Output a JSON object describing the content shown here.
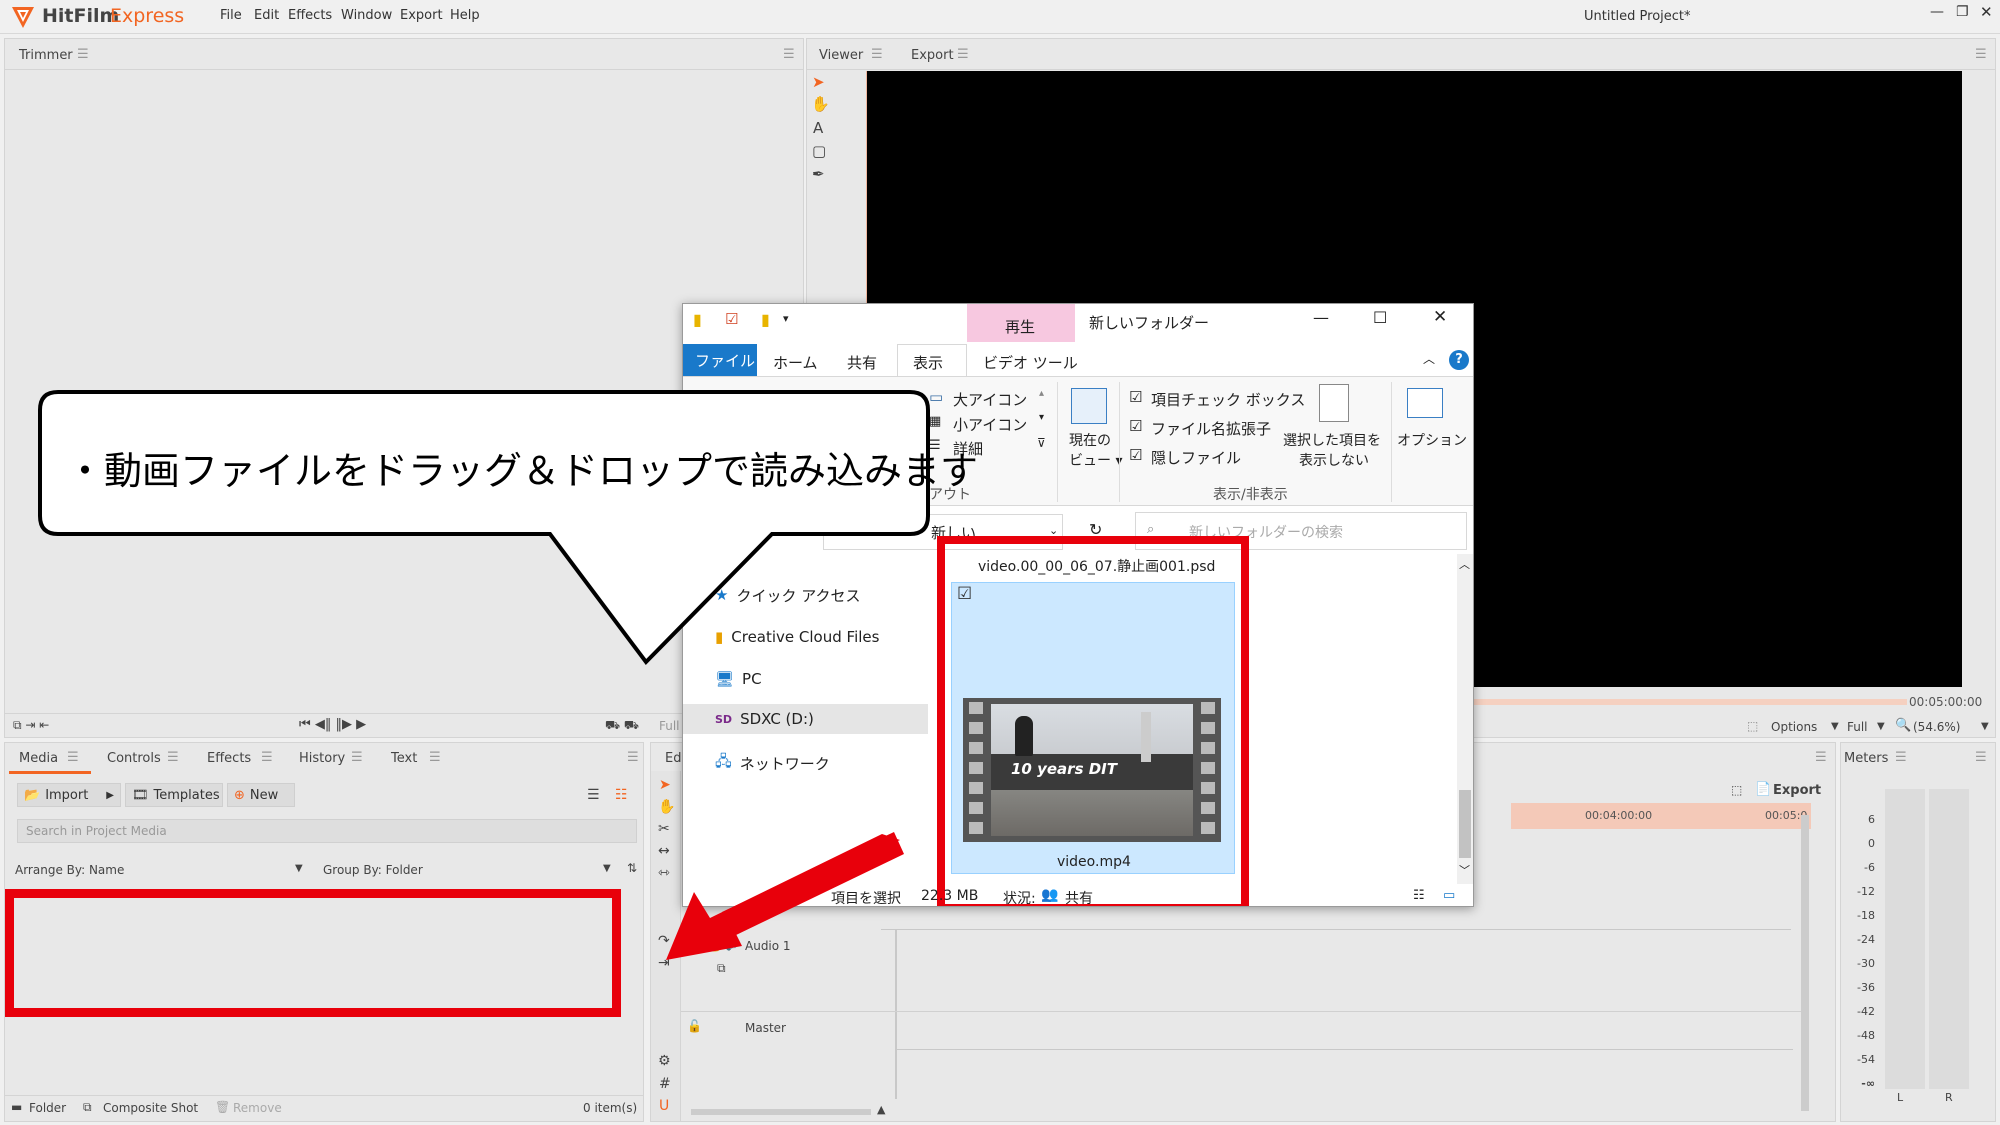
{
  "app": {
    "logo_text": "HitFilm",
    "logo_sub": "Express",
    "project_title": "Untitled Project*",
    "menu": [
      "File",
      "Edit",
      "Effects",
      "Window",
      "Export",
      "Help"
    ],
    "window_controls": [
      "—",
      "❐",
      "✕"
    ]
  },
  "trimmer": {
    "tab": "Trimmer",
    "full_label": "Full"
  },
  "viewer": {
    "tabs": [
      "Viewer",
      "Export"
    ],
    "timecode": "00:05:00:00",
    "options_label": "Options",
    "full_label": "Full",
    "zoom": "(54.6%)"
  },
  "media_panel": {
    "tabs": [
      "Media",
      "Controls",
      "Effects",
      "History",
      "Text"
    ],
    "import_label": "Import",
    "templates_label": "Templates",
    "new_label": "New",
    "search_placeholder": "Search in Project Media",
    "arrange_by": "Arrange By: Name",
    "group_by": "Group By: Folder",
    "folder_label": "Folder",
    "composite_label": "Composite Shot",
    "remove_label": "Remove",
    "items_count": "0 item(s)"
  },
  "editor": {
    "tab": "Edi",
    "export_label": "Export",
    "ruler": [
      "00:04:00:00",
      "00:05:0"
    ],
    "tracks": [
      "Audio 1",
      "Master"
    ]
  },
  "meters": {
    "tab": "Meters",
    "scale": [
      "6",
      "0",
      "-6",
      "-12",
      "-18",
      "-24",
      "-30",
      "-36",
      "-42",
      "-48",
      "-54",
      "-∞"
    ],
    "channels": [
      "L",
      "R"
    ]
  },
  "explorer": {
    "context_tab": "再生",
    "title": "新しいフォルダー",
    "ribbon_tabs": [
      "ファイル",
      "ホーム",
      "共有",
      "表示",
      "ビデオ ツール"
    ],
    "layout_items": [
      "大アイコン",
      "小アイコン",
      "詳細"
    ],
    "layout_group": "アウト",
    "current_view": [
      "現在の",
      "ビュー ▾"
    ],
    "checkboxes": [
      "項目チェック ボックス",
      "ファイル名拡張子",
      "隠しファイル"
    ],
    "hide_selected": [
      "選択した項目を",
      "表示しない"
    ],
    "options_label": "オプション",
    "showhide_group": "表示/非表示",
    "address_text": "新しい",
    "search_placeholder": "新しいフォルダーの検索",
    "nav": [
      "クイック アクセス",
      "Creative Cloud Files",
      "PC",
      "SDXC (D:)",
      "ネットワーク"
    ],
    "file_top": "video.00_00_06_07.静止画001.psd",
    "file_selected": "video.mp4",
    "thumb_caption": "10 years DIT",
    "status_selected": "項目を選択",
    "status_size": "22.3 MB",
    "status_state": "状況:",
    "status_shared": "共有"
  },
  "callout": {
    "text": "・動画ファイルをドラッグ＆ドロップで読み込みます"
  },
  "colors": {
    "accent": "#f26522",
    "annotation_red": "#e8000b",
    "explorer_blue": "#1979ca",
    "selection_blue": "#cce8ff"
  }
}
